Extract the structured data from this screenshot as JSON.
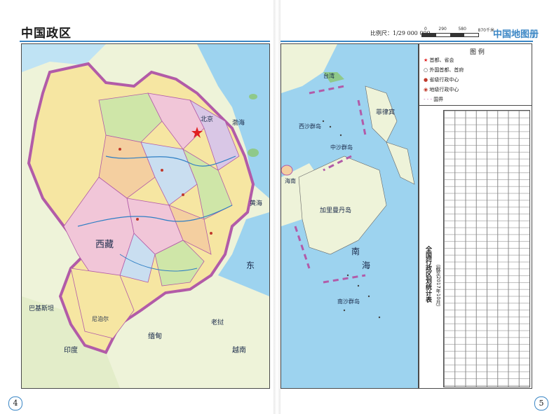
{
  "header": {
    "title_left": "中国政区",
    "scale_label": "比例尺：1/29 000 000",
    "scale_ticks": [
      "0",
      "290",
      "580",
      "870千米"
    ],
    "title_right": "中国地图册"
  },
  "pages": {
    "left_number": "4",
    "right_number": "5"
  },
  "map_labels": {
    "sea_east": "东",
    "sea_south": "南",
    "sea_hai": "海",
    "bohai": "渤海",
    "yellow_sea": "黄海",
    "philippines": "菲律宾",
    "vietnam": "越南",
    "laos": "老挝",
    "myanmar": "缅甸",
    "india": "印度",
    "pakistan": "巴基斯坦",
    "nepal": "尼泊尔",
    "tibet": "西藏",
    "taiwan": "台湾",
    "hainan": "海南",
    "beijing": "北京",
    "kalimantan": "加里曼丹岛",
    "xisha": "西沙群岛",
    "zhongsha": "中沙群岛",
    "nansha": "南沙群岛"
  },
  "legend": {
    "title": "图 例",
    "items": [
      {
        "icon": "red-star-icon",
        "label": "首都、省会"
      },
      {
        "icon": "circle-icon",
        "label": "外国首都、首府"
      },
      {
        "icon": "dot-icon",
        "label": "省级行政中心"
      },
      {
        "icon": "double-dot-icon",
        "label": "地级行政中心"
      },
      {
        "icon": "dashed-line-icon",
        "label": "国界"
      }
    ]
  },
  "table": {
    "title": "全国行政区划统计表",
    "subtitle": "（截至2017年10月）"
  },
  "colors": {
    "sea": "#9dd3ef",
    "frame_blue": "#3a86c5",
    "province_yellow": "#f6e6a2",
    "province_green": "#cfe6a8",
    "province_pink": "#f1c6d8",
    "province_purple": "#d9c7e6",
    "province_orange": "#f4cfa0",
    "province_lightblue": "#c9def0",
    "border_purple": "#b25ba8"
  }
}
